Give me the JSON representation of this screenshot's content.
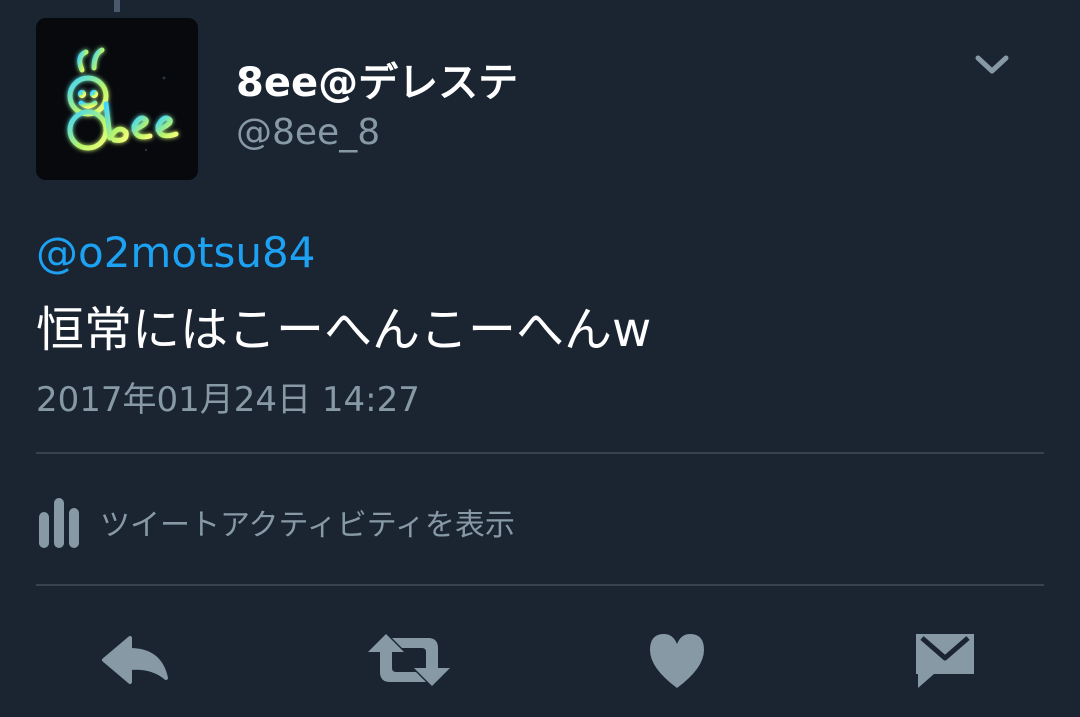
{
  "tweet": {
    "author": {
      "display_name": "8ee@デレステ",
      "handle": "@8ee_8",
      "avatar_text": "8ee"
    },
    "mention": "@o2motsu84",
    "text": "恒常にはこーへんこーへんw",
    "timestamp": "2017年01月24日 14:27"
  },
  "activity": {
    "label": "ツイートアクティビティを表示"
  },
  "actions": {
    "icons": [
      "reply-icon",
      "retweet-icon",
      "like-icon",
      "direct-message-icon"
    ]
  },
  "colors": {
    "background": "#1b2532",
    "text_primary": "#ffffff",
    "text_secondary": "#8899a6",
    "link": "#1da1f2",
    "divider": "#38444d",
    "icon": "#8899a6"
  }
}
